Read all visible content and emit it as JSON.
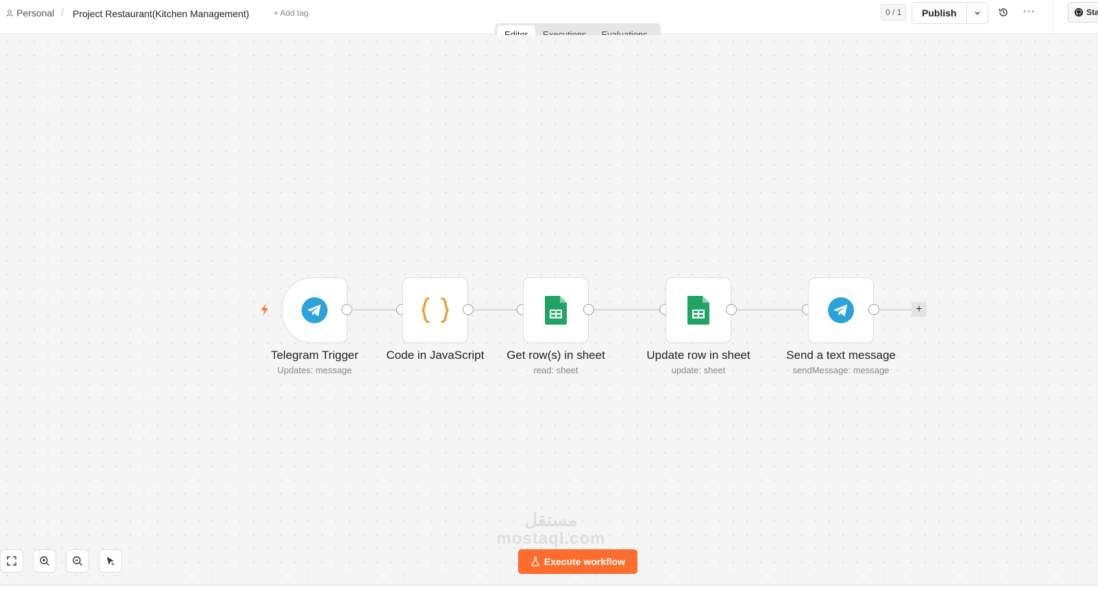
{
  "header": {
    "breadcrumb_owner": "Personal",
    "breadcrumb_sep": "/",
    "workflow_title": "Project Restaurant(Kitchen Management)",
    "add_tag": "+ Add tag",
    "counter": "0 / 1",
    "publish_label": "Publish",
    "more_label": "···",
    "star_label": "Sta"
  },
  "tabs": [
    {
      "label": "Editor",
      "active": true
    },
    {
      "label": "Executions",
      "active": false
    },
    {
      "label": "Evaluations",
      "active": false
    }
  ],
  "nodes": [
    {
      "label": "Telegram Trigger",
      "subtitle": "Updates: message",
      "icon": "telegram-icon"
    },
    {
      "label": "Code in JavaScript",
      "subtitle": "",
      "icon": "code-braces-icon"
    },
    {
      "label": "Get row(s) in sheet",
      "subtitle": "read: sheet",
      "icon": "google-sheets-icon"
    },
    {
      "label": "Update row in sheet",
      "subtitle": "update: sheet",
      "icon": "google-sheets-icon"
    },
    {
      "label": "Send a text message",
      "subtitle": "sendMessage: message",
      "icon": "telegram-icon"
    }
  ],
  "footer": {
    "execute_label": "Execute workflow",
    "watermark_ar": "مستقل",
    "watermark_en": "mostaql.com"
  },
  "colors": {
    "accent": "#ff6d2e",
    "telegram": "#2aa3dc",
    "sheets": "#1fa463",
    "code": "#f0a030"
  }
}
